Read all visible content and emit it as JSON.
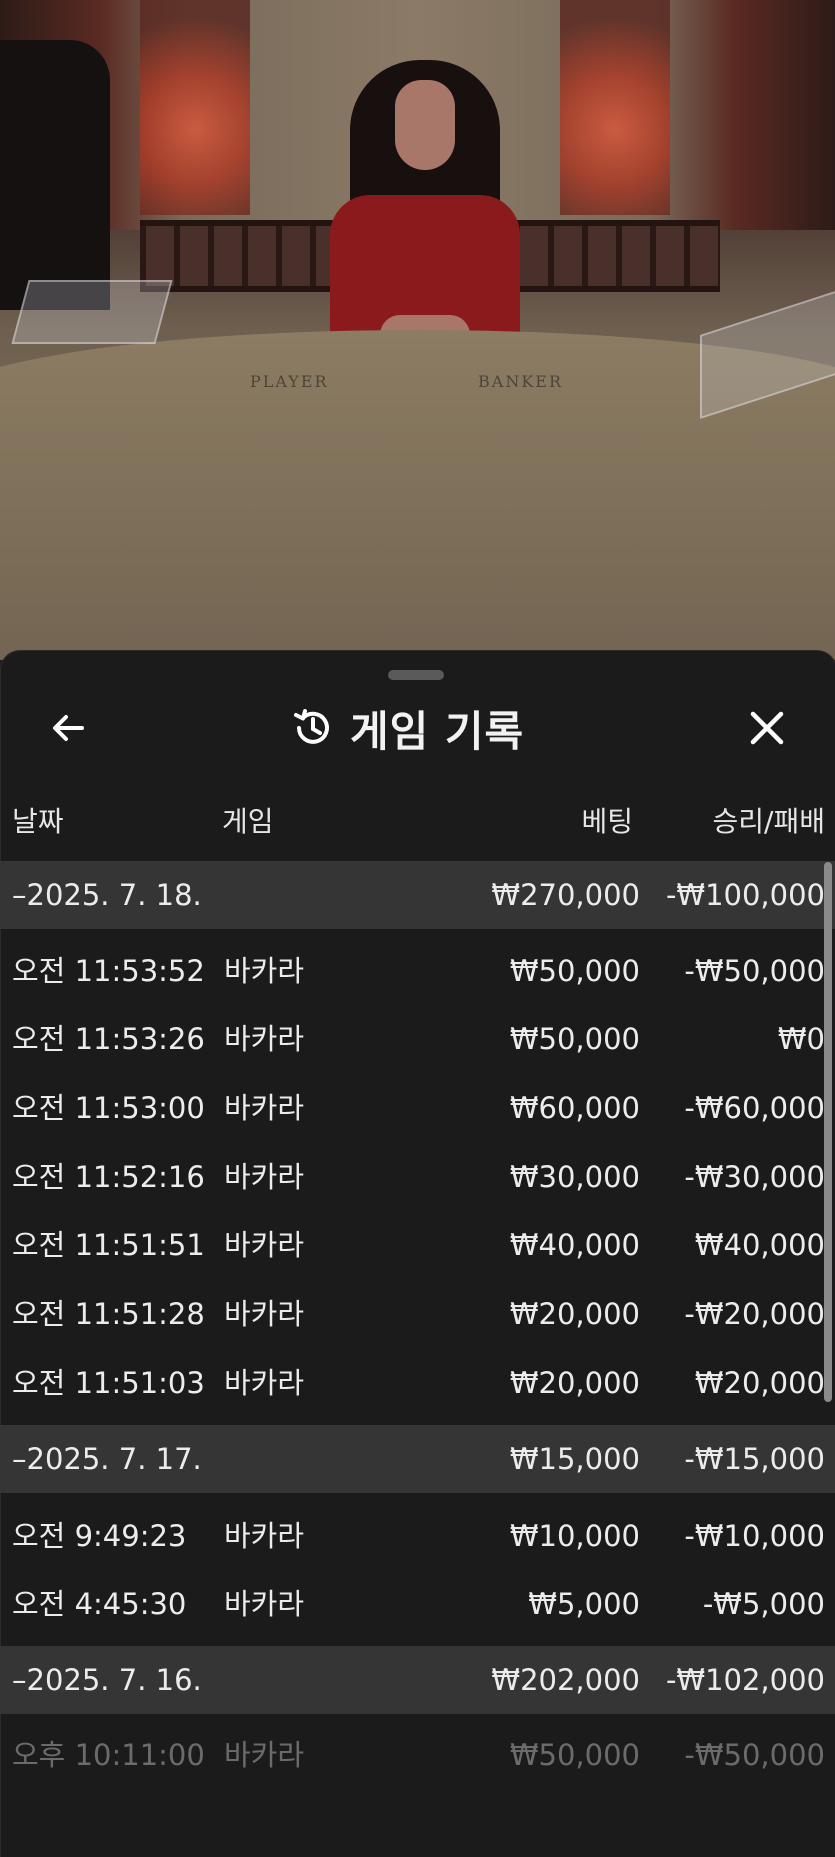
{
  "panel": {
    "title": "게임 기록",
    "icons": {
      "back": "arrow-left-icon",
      "history": "history-icon",
      "close": "close-icon"
    }
  },
  "table_labels": {
    "player": "PLAYER",
    "banker": "BANKER"
  },
  "columns": {
    "date": "날짜",
    "game": "게임",
    "bet": "베팅",
    "result": "승리/패배"
  },
  "groups": [
    {
      "date": "–2025. 7. 18.",
      "total_bet": "₩270,000",
      "total_result": "-₩100,000",
      "rows": [
        {
          "time": "오전 11:53:52",
          "game": "바카라",
          "bet": "₩50,000",
          "result": "-₩50,000"
        },
        {
          "time": "오전 11:53:26",
          "game": "바카라",
          "bet": "₩50,000",
          "result": "₩0"
        },
        {
          "time": "오전 11:53:00",
          "game": "바카라",
          "bet": "₩60,000",
          "result": "-₩60,000"
        },
        {
          "time": "오전 11:52:16",
          "game": "바카라",
          "bet": "₩30,000",
          "result": "-₩30,000"
        },
        {
          "time": "오전 11:51:51",
          "game": "바카라",
          "bet": "₩40,000",
          "result": "₩40,000"
        },
        {
          "time": "오전 11:51:28",
          "game": "바카라",
          "bet": "₩20,000",
          "result": "-₩20,000"
        },
        {
          "time": "오전 11:51:03",
          "game": "바카라",
          "bet": "₩20,000",
          "result": "₩20,000"
        }
      ]
    },
    {
      "date": "–2025. 7. 17.",
      "total_bet": "₩15,000",
      "total_result": "-₩15,000",
      "rows": [
        {
          "time": "오전 9:49:23",
          "game": "바카라",
          "bet": "₩10,000",
          "result": "-₩10,000"
        },
        {
          "time": "오전 4:45:30",
          "game": "바카라",
          "bet": "₩5,000",
          "result": "-₩5,000"
        }
      ]
    },
    {
      "date": "–2025. 7. 16.",
      "total_bet": "₩202,000",
      "total_result": "-₩102,000",
      "rows": [
        {
          "time": "오후 10:11:00",
          "game": "바카라",
          "bet": "₩50,000",
          "result": "-₩50,000"
        }
      ]
    }
  ]
}
